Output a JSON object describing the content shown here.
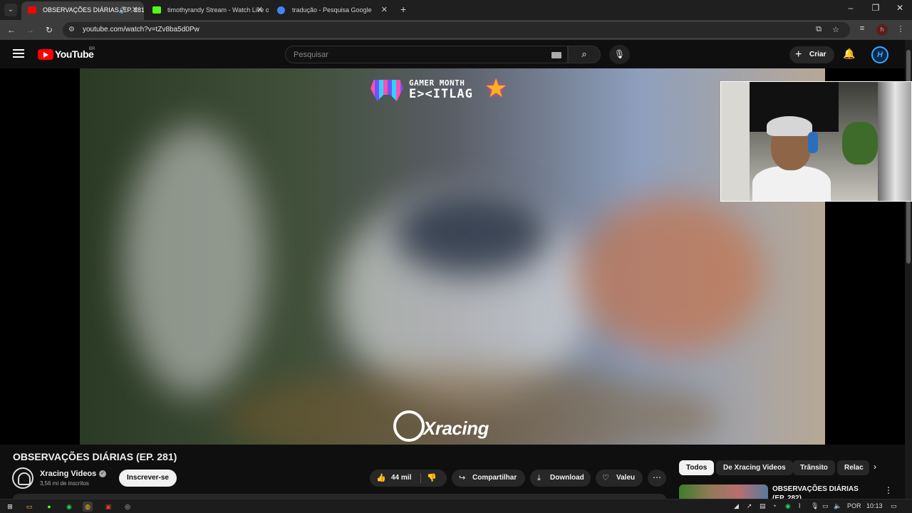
{
  "browser": {
    "tabs": [
      {
        "title": "OBSERVAÇÕES DIÁRIAS (EP. 281)",
        "active": true,
        "favicon_color": "#ff0000"
      },
      {
        "title": "timothyrandy Stream - Watch Live on Kick",
        "active": false,
        "favicon_color": "#53fc18"
      },
      {
        "title": "tradução - Pesquisa Google",
        "active": false,
        "favicon_color": "#4285f4"
      }
    ],
    "url": "youtube.com/watch?v=tZv8ba5d0Pw",
    "profile_initial": "h"
  },
  "youtube": {
    "logo_text": "YouTube",
    "region": "BR",
    "search_placeholder": "Pesquisar",
    "create_label": "Criar",
    "avatar_letter": "H"
  },
  "video": {
    "overlay_top_line1": "GAMER MONTH",
    "overlay_top_line2": "E><ITLAG",
    "watermark": "Xracing",
    "title": "OBSERVAÇÕES DIÁRIAS (EP. 281)"
  },
  "channel": {
    "name": "Xracing Videos",
    "subscribers": "3,56 mi de inscritos",
    "subscribe_label": "Inscrever-se"
  },
  "actions": {
    "likes": "44 mil",
    "share": "Compartilhar",
    "download": "Download",
    "thanks": "Valeu"
  },
  "chips": [
    "Todos",
    "De Xracing Videos",
    "Trânsito",
    "Relac"
  ],
  "recommendation": {
    "title": "OBSERVAÇÕES DIÁRIAS (EP. 282)"
  },
  "taskbar": {
    "language": "POR",
    "time": "10:13"
  },
  "colors": {
    "bg": "#0f0f0f",
    "accent_red": "#ff0000",
    "accent_blue": "#3ea6ff"
  }
}
